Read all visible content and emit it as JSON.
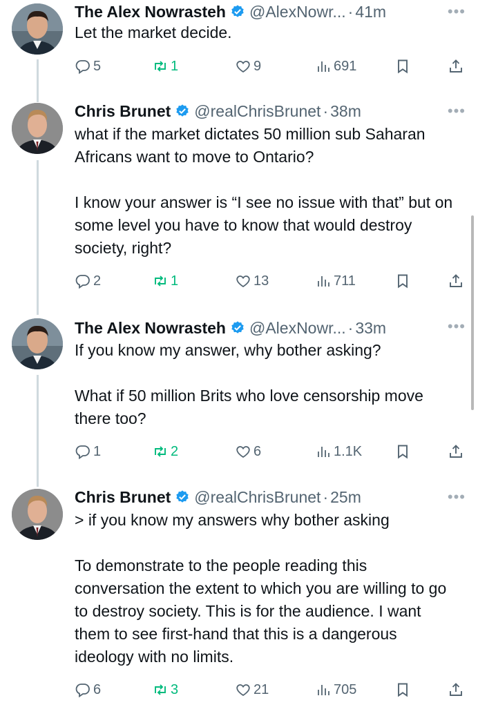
{
  "tweets": [
    {
      "name": "The Alex Nowrasteh",
      "handle": "@AlexNowr...",
      "time": "41m",
      "paragraphs": [
        "Let the market decide."
      ],
      "replies": "5",
      "retweets": "1",
      "likes": "9",
      "views": "691",
      "avatar": "alex"
    },
    {
      "name": "Chris Brunet",
      "handle": "@realChrisBrunet",
      "time": "38m",
      "paragraphs": [
        "what if the market dictates 50 million sub Saharan Africans want to move to Ontario?",
        "I know your answer is “I see no issue with that” but on some level you have to know that would destroy society, right?"
      ],
      "replies": "2",
      "retweets": "1",
      "likes": "13",
      "views": "711",
      "avatar": "chris"
    },
    {
      "name": "The Alex Nowrasteh",
      "handle": "@AlexNowr...",
      "time": "33m",
      "paragraphs": [
        "If you know my answer, why bother asking?",
        "What if 50 million Brits who love censorship move there too?"
      ],
      "replies": "1",
      "retweets": "2",
      "likes": "6",
      "views": "1.1K",
      "avatar": "alex"
    },
    {
      "name": "Chris Brunet",
      "handle": "@realChrisBrunet",
      "time": "25m",
      "paragraphs": [
        "> if you know my answers why bother asking",
        "To demonstrate to the people reading this conversation the extent to which you are willing to go to destroy society. This is for the audience. I want them to see first-hand that this is a dangerous ideology with no limits."
      ],
      "replies": "6",
      "retweets": "3",
      "likes": "21",
      "views": "705",
      "avatar": "chris"
    }
  ],
  "ui": {
    "separator_dot": "·",
    "more_glyph": "•••"
  },
  "colors": {
    "text": "#0f1419",
    "secondary": "#536471",
    "retweet_green": "#00ba7c",
    "verified_blue": "#1d9bf0",
    "thread_line": "#cfd9de"
  },
  "icons": [
    "reply-icon",
    "retweet-icon",
    "like-icon",
    "views-icon",
    "bookmark-icon",
    "share-icon",
    "verified-icon",
    "more-icon"
  ]
}
